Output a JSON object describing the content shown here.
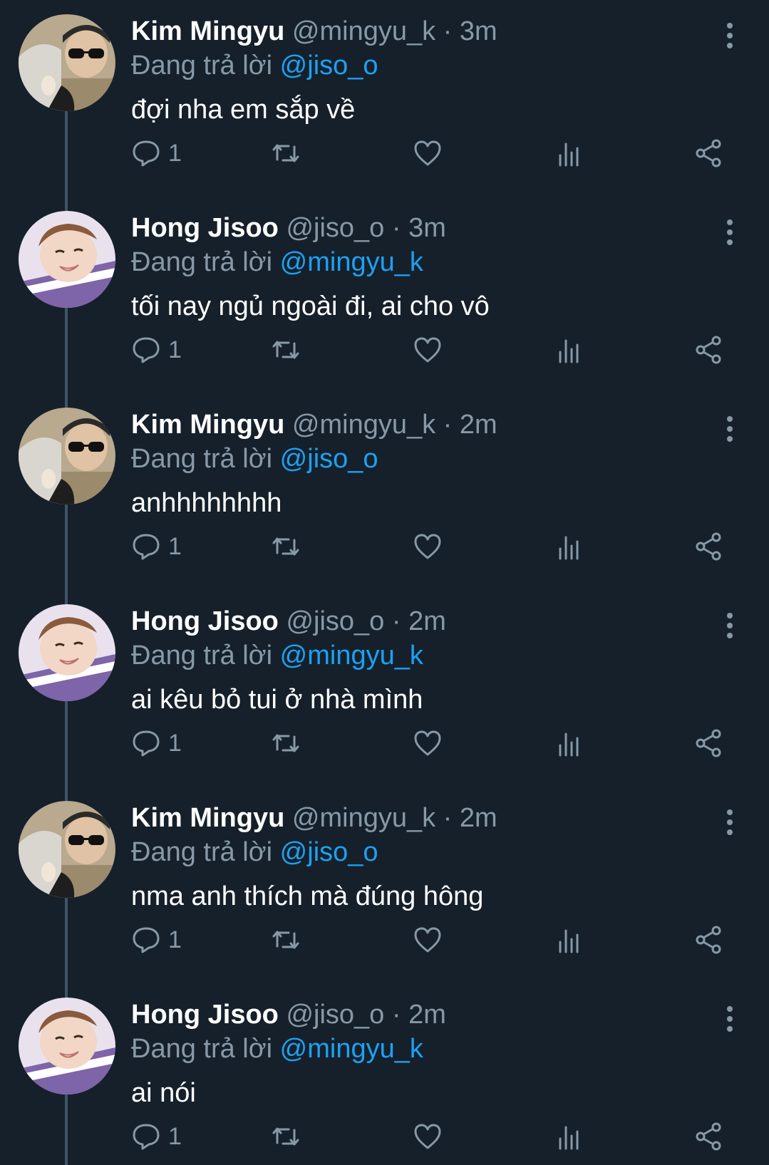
{
  "reply_prefix": "Đang trả lời",
  "colors": {
    "background": "#15202b",
    "secondary_text": "#8899a6",
    "mention": "#1da1f2",
    "thread_line": "#3d5466"
  },
  "tweets": [
    {
      "name": "Kim Mingyu",
      "handle": "@mingyu_k",
      "separator": "·",
      "time": "3m",
      "reply_to": "@jiso_o",
      "text": "đợi nha em sắp về",
      "reply_count": "1",
      "avatar": "avatar-mingyu"
    },
    {
      "name": "Hong Jisoo",
      "handle": "@jiso_o",
      "separator": "·",
      "time": "3m",
      "reply_to": "@mingyu_k",
      "text": "tối nay ngủ ngoài đi, ai cho vô",
      "reply_count": "1",
      "avatar": "avatar-jisoo"
    },
    {
      "name": "Kim Mingyu",
      "handle": "@mingyu_k",
      "separator": "·",
      "time": "2m",
      "reply_to": "@jiso_o",
      "text": "anhhhhhhhh",
      "reply_count": "1",
      "avatar": "avatar-mingyu"
    },
    {
      "name": "Hong Jisoo",
      "handle": "@jiso_o",
      "separator": "·",
      "time": "2m",
      "reply_to": "@mingyu_k",
      "text": "ai kêu bỏ tui ở nhà mình",
      "reply_count": "1",
      "avatar": "avatar-jisoo"
    },
    {
      "name": "Kim Mingyu",
      "handle": "@mingyu_k",
      "separator": "·",
      "time": "2m",
      "reply_to": "@jiso_o",
      "text": "nma anh thích mà đúng hông",
      "reply_count": "1",
      "avatar": "avatar-mingyu"
    },
    {
      "name": "Hong Jisoo",
      "handle": "@jiso_o",
      "separator": "·",
      "time": "2m",
      "reply_to": "@mingyu_k",
      "text": "ai nói",
      "reply_count": "1",
      "avatar": "avatar-jisoo"
    }
  ],
  "icons": {
    "reply": "reply-icon",
    "retweet": "retweet-icon",
    "like": "heart-icon",
    "analytics": "analytics-icon",
    "share": "share-icon",
    "more": "more-vertical-icon"
  }
}
